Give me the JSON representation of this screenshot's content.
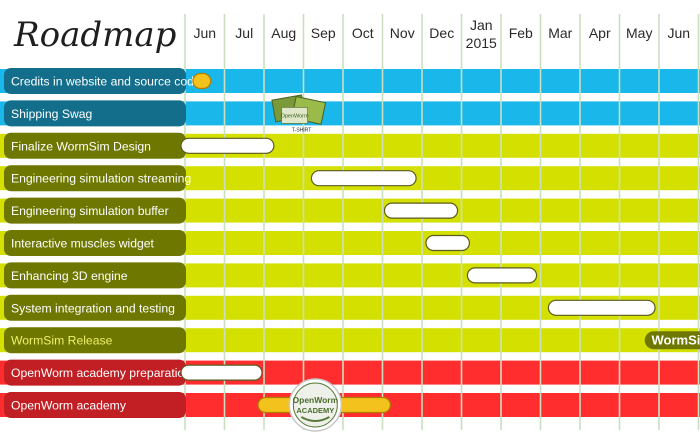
{
  "title": "Roadmap",
  "colors": {
    "background": "#ffffff",
    "gridline": "#c9dfc0",
    "bar_fill": "#ffffff",
    "bar_stroke": "#5a5a20",
    "highlight_fill": "#f3c21c",
    "highlight_stroke": "#b07d00",
    "text_dark": "#2a2a2a",
    "text_light": "#ffffff",
    "wormsim_text": "#f0f06a"
  },
  "chart_data": {
    "type": "gantt",
    "title": "Roadmap",
    "time_axis": {
      "months": [
        "Jun",
        "Jul",
        "Aug",
        "Sep",
        "Oct",
        "Nov",
        "Dec",
        "Jan",
        "Feb",
        "Mar",
        "Apr",
        "May",
        "Jun"
      ],
      "year_marker": {
        "month_index": 7,
        "label": "2015"
      }
    },
    "tasks": [
      {
        "label": "Credits in website and source code",
        "label_color": "#136e8c",
        "band_color": "#1ab7ea",
        "start": 0.2,
        "end": 0.65,
        "style": "highlight"
      },
      {
        "label": "Shipping Swag",
        "label_color": "#136e8c",
        "band_color": "#1ab7ea",
        "style": "none",
        "badge": {
          "month": 2.3,
          "text": "OpenWorm",
          "sub": "T-SHIRT"
        }
      },
      {
        "label": "Finalize WormSim Design",
        "label_color": "#6e7800",
        "band_color": "#d4e100",
        "start": -0.4,
        "end": 2.25,
        "style": "bar"
      },
      {
        "label": "Engineering simulation streaming",
        "label_color": "#6e7800",
        "band_color": "#d4e100",
        "start": 3.2,
        "end": 5.85,
        "style": "bar"
      },
      {
        "label": "Engineering simulation buffer",
        "label_color": "#6e7800",
        "band_color": "#d4e100",
        "start": 5.05,
        "end": 6.9,
        "style": "bar"
      },
      {
        "label": "Interactive muscles widget",
        "label_color": "#6e7800",
        "band_color": "#d4e100",
        "start": 6.1,
        "end": 7.2,
        "style": "bar"
      },
      {
        "label": "Enhancing 3D engine",
        "label_color": "#6e7800",
        "band_color": "#d4e100",
        "start": 7.15,
        "end": 8.9,
        "style": "bar"
      },
      {
        "label": "System integration and testing",
        "label_color": "#6e7800",
        "band_color": "#d4e100",
        "start": 9.2,
        "end": 11.9,
        "style": "bar"
      },
      {
        "label": "WormSim Release",
        "label_color": "#6e7800",
        "band_color": "#d4e100",
        "style": "release",
        "text_color": "#f0f06a",
        "badge": {
          "month": 12.05,
          "text": "WormSim"
        }
      },
      {
        "label": "OpenWorm academy preparation",
        "label_color": "#c11f24",
        "band_color": "#ff2d2d",
        "start": -0.4,
        "end": 1.95,
        "style": "bar"
      },
      {
        "label": "OpenWorm academy",
        "label_color": "#c11f24",
        "band_color": "#ff2d2d",
        "start": 1.85,
        "end": 5.2,
        "style": "highlight",
        "badge": {
          "month": 2.8,
          "text": "OpenWorm",
          "sub": "ACADEMY",
          "style": "circle"
        }
      }
    ]
  }
}
